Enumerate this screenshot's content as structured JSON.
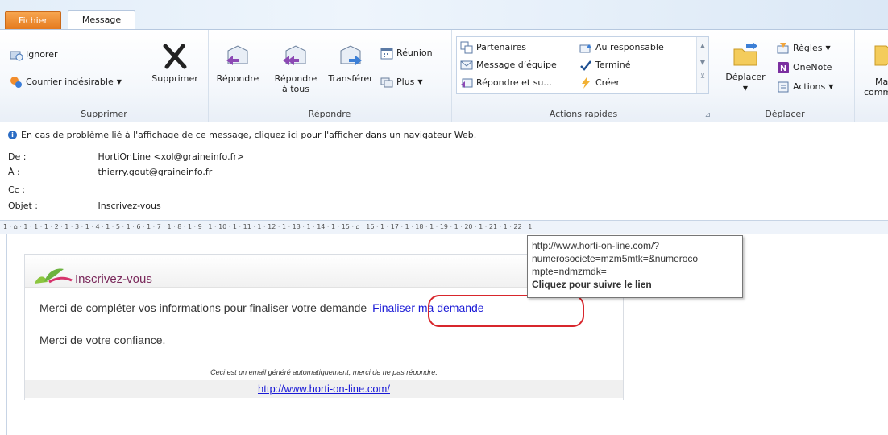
{
  "tabs": {
    "file": "Fichier",
    "message": "Message"
  },
  "ribbon": {
    "supprimer": {
      "label": "Supprimer",
      "ignore": "Ignorer",
      "junk": "Courrier indésirable",
      "delete": "Supprimer"
    },
    "repondre": {
      "label": "Répondre",
      "reply": "Répondre",
      "reply_all_1": "Répondre",
      "reply_all_2": "à tous",
      "forward": "Transférer",
      "meeting": "Réunion",
      "more": "Plus"
    },
    "quick_steps": {
      "label": "Actions rapides",
      "items": [
        "Partenaires",
        "Message d’équipe",
        "Répondre et su...",
        "Au responsable",
        "Terminé",
        "Créer"
      ]
    },
    "deplacer": {
      "label": "Déplacer",
      "move": "Déplacer",
      "rules": "Règles",
      "onenote": "OneNote",
      "actions": "Actions"
    },
    "cut_label_1": "Ma",
    "cut_label_2": "comm"
  },
  "info": {
    "notice": "En cas de problème lié à l'affichage de ce message, cliquez ici pour l'afficher dans un navigateur Web.",
    "from_label": "De :",
    "from_value": "HortiOnLine <xol@graineinfo.fr>",
    "to_label": "À :",
    "to_value": "thierry.gout@graineinfo.fr",
    "cc_label": "Cc :",
    "cc_value": "",
    "subject_label": "Objet :",
    "subject_value": "Inscrivez-vous"
  },
  "ruler_text": "1 · ⌂ · 1 · 1 · 1 · 2 · 1 · 3 · 1 · 4 · 1 · 5 · 1 · 6 · 1 · 7 · 1 · 8 · 1 · 9 · 1 · 10 · 1 · 11 · 1 · 12 · 1 · 13 · 1 · 14 · 1 · 15 · ⌂ · 16 · 1 · 17 · 1 · 18 · 1 · 19 · 1 · 20 · 1 · 21 · 1 · 22 · 1",
  "email": {
    "brand": "Inscrivez-vous",
    "line1": "Merci de compléter vos informations pour finaliser votre demande",
    "link": "Finaliser ma demande",
    "line2": "Merci de votre confiance.",
    "auto_note": "Ceci est un email généré automatiquement, merci de ne pas répondre.",
    "site": "http://www.horti-on-line.com/"
  },
  "tooltip": {
    "line1": "http://www.horti-on-line.com/?",
    "line2": "numerosociete=mzm5mtk=&numeroco",
    "line3": "mpte=ndmzmdk=",
    "line4": "Cliquez pour suivre le lien"
  },
  "colors": {
    "file_tab": "#e57a1e",
    "link": "#1a1ad6",
    "highlight": "#d8262c",
    "brand": "#7b2a5c"
  }
}
